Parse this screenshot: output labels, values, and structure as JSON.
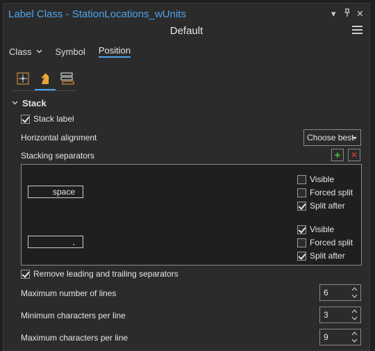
{
  "window": {
    "title": "Label Class - StationLocations_wUnits",
    "subtitle": "Default",
    "btn_menu": "▾",
    "btn_pin": "⊕",
    "btn_close": "✕"
  },
  "tabs": [
    {
      "label": "Class"
    },
    {
      "label": "Symbol"
    },
    {
      "label": "Position"
    }
  ],
  "icons": [
    "position-icon",
    "chess-knight-icon",
    "stack-icon"
  ],
  "stack": {
    "section_title": "Stack",
    "stack_label": "Stack label",
    "horizontal_alignment_label": "Horizontal alignment",
    "horizontal_alignment_value": "Choose best",
    "stacking_separators_label": "Stacking separators",
    "add": "+",
    "remove": "✕",
    "separators": [
      {
        "value": "space",
        "visible_label": "Visible",
        "visible": false,
        "forced_label": "Forced split",
        "forced": false,
        "after_label": "Split after",
        "after": true
      },
      {
        "value": ",",
        "visible_label": "Visible",
        "visible": true,
        "forced_label": "Forced split",
        "forced": false,
        "after_label": "Split after",
        "after": true
      }
    ],
    "remove_leading_label": "Remove leading and trailing separators",
    "max_lines_label": "Maximum number of lines",
    "max_lines_value": "6",
    "min_chars_label": "Minimum characters per line",
    "min_chars_value": "3",
    "max_chars_label": "Maximum characters per line",
    "max_chars_value": "9"
  },
  "colors": {
    "accent": "#4ea4ee",
    "add": "#3fbf3f",
    "remove": "#e04545"
  }
}
